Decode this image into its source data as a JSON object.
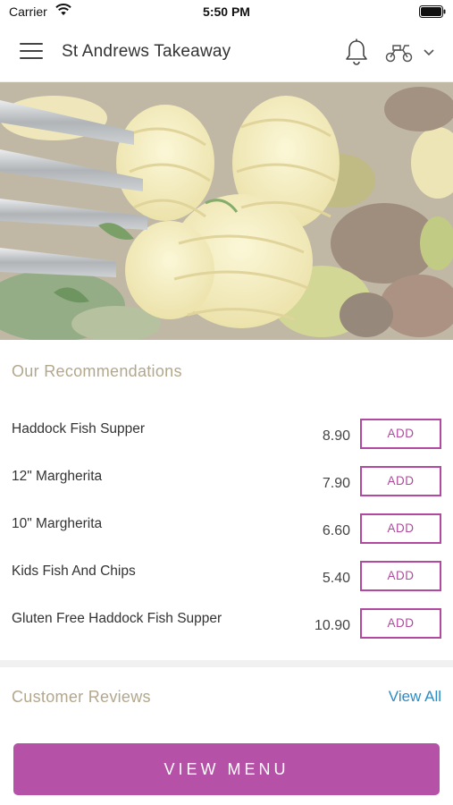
{
  "status_bar": {
    "carrier": "Carrier",
    "time": "5:50 PM"
  },
  "header": {
    "title": "St Andrews Takeaway"
  },
  "recommendations": {
    "title": "Our Recommendations",
    "items": [
      {
        "name": "Haddock Fish Supper",
        "price": "8.90",
        "action": "ADD"
      },
      {
        "name": "12\" Margherita",
        "price": "7.90",
        "action": "ADD"
      },
      {
        "name": "10\" Margherita",
        "price": "6.60",
        "action": "ADD"
      },
      {
        "name": "Kids Fish And Chips",
        "price": "5.40",
        "action": "ADD"
      },
      {
        "name": "Gluten Free Haddock Fish Supper",
        "price": "10.90",
        "action": "ADD"
      }
    ]
  },
  "reviews": {
    "title": "Customer Reviews",
    "view_all": "View All"
  },
  "footer": {
    "view_menu": "VIEW MENU"
  },
  "colors": {
    "accent": "#b552a8",
    "section_title": "#b3a78c",
    "link": "#2a8cc7"
  }
}
